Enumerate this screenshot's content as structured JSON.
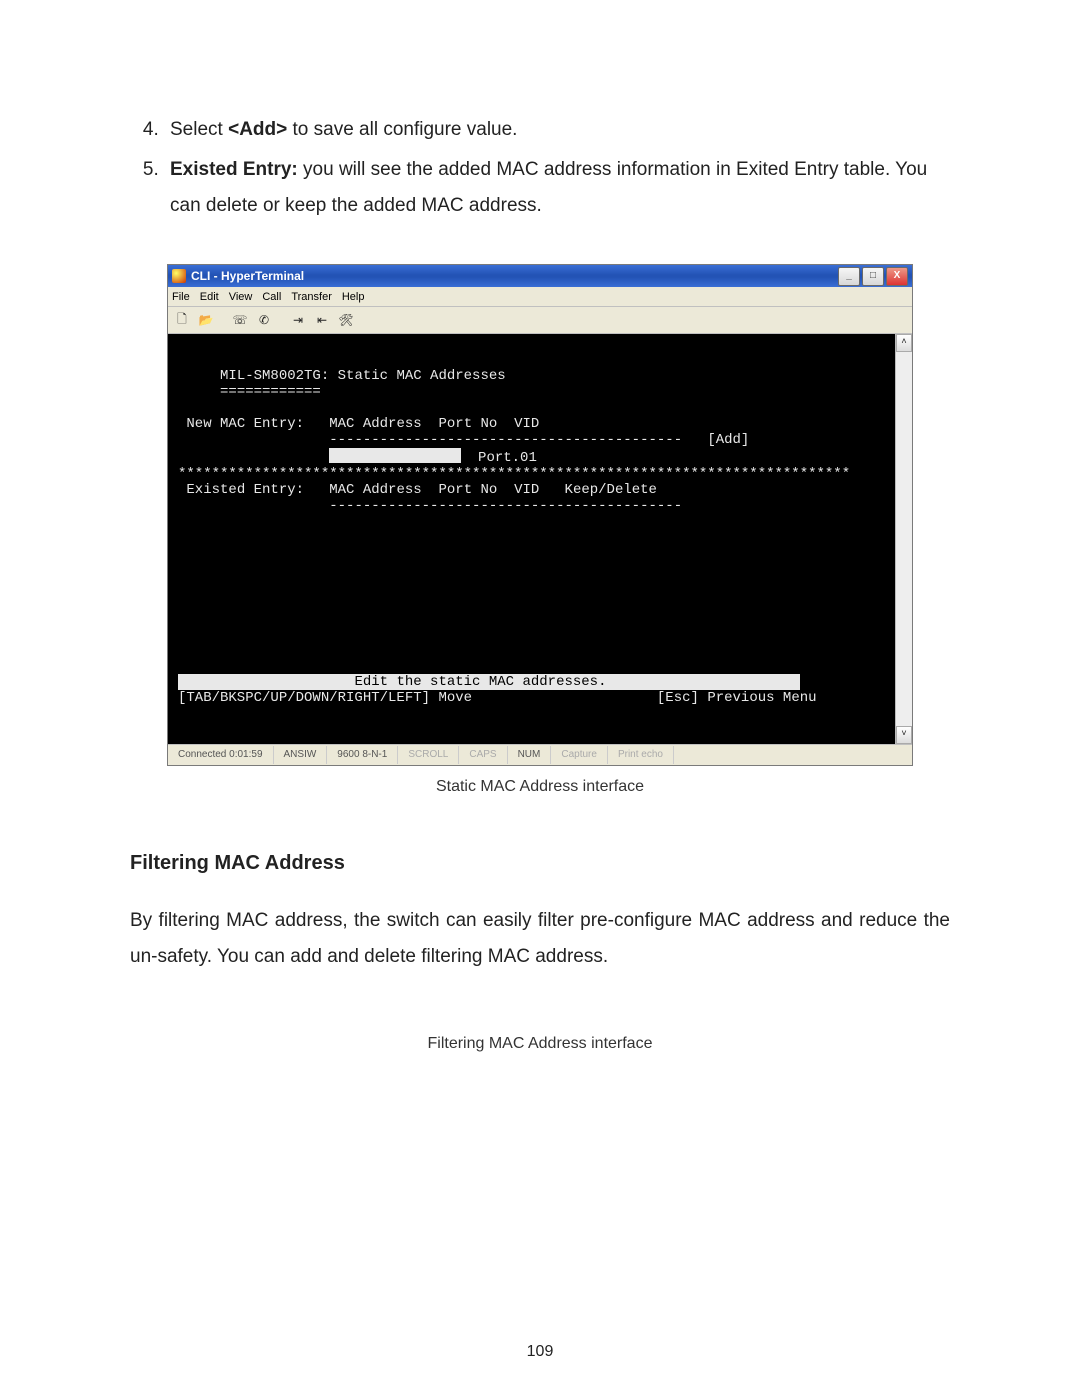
{
  "instructions": {
    "item4_prefix": "Select ",
    "item4_code": "<Add>",
    "item4_suffix": " to save all configure value.",
    "item5_label": "Existed Entry:",
    "item5_rest": " you will see the added MAC address information in Exited Entry table. You can delete or keep the added MAC address."
  },
  "caption1": "Static MAC Address interface",
  "section2_title": "Filtering MAC Address",
  "section2_body": "By filtering MAC address, the switch can easily filter pre-configure MAC address and reduce the un-safety. You can add and delete filtering MAC address.",
  "caption2": "Filtering MAC Address interface",
  "page_number": "109",
  "hyperterminal": {
    "title": "CLI - HyperTerminal",
    "menus": [
      "File",
      "Edit",
      "View",
      "Call",
      "Transfer",
      "Help"
    ],
    "toolbar_icons": [
      "new-file-icon",
      "open-folder-icon",
      "connect-icon",
      "disconnect-icon",
      "send-icon",
      "receive-icon",
      "properties-icon"
    ],
    "terminal": {
      "title_line": "MIL-SM8002TG: Static MAC Addresses",
      "underline": "============",
      "new_label": "New MAC Entry:",
      "cols_mac": "MAC Address",
      "cols_port": "Port No",
      "cols_vid": "VID",
      "dashes1": "------------------------------------------",
      "add_btn": "[Add]",
      "port_value": "Port.01",
      "separator": "********************************************************************************",
      "existed_label": "Existed Entry:",
      "cols_keep": "Keep/Delete",
      "dashes2": "------------------------------------------",
      "footer_title_fill_left": "                     ",
      "footer_title": "Edit the static MAC addresses.",
      "footer_title_fill_right": "                       ",
      "footer_left": "[TAB/BKSPC/UP/DOWN/RIGHT/LEFT] Move",
      "footer_gap": "                      ",
      "footer_right": "[Esc] Previous Menu"
    },
    "status": {
      "connected": "Connected 0:01:59",
      "emu": "ANSIW",
      "port": "9600 8-N-1",
      "scroll": "SCROLL",
      "caps": "CAPS",
      "num": "NUM",
      "capture": "Capture",
      "printecho": "Print echo"
    },
    "winbtn_min": "_",
    "winbtn_max": "□",
    "winbtn_close": "X",
    "scroll_up": "˄",
    "scroll_down": "˅"
  }
}
